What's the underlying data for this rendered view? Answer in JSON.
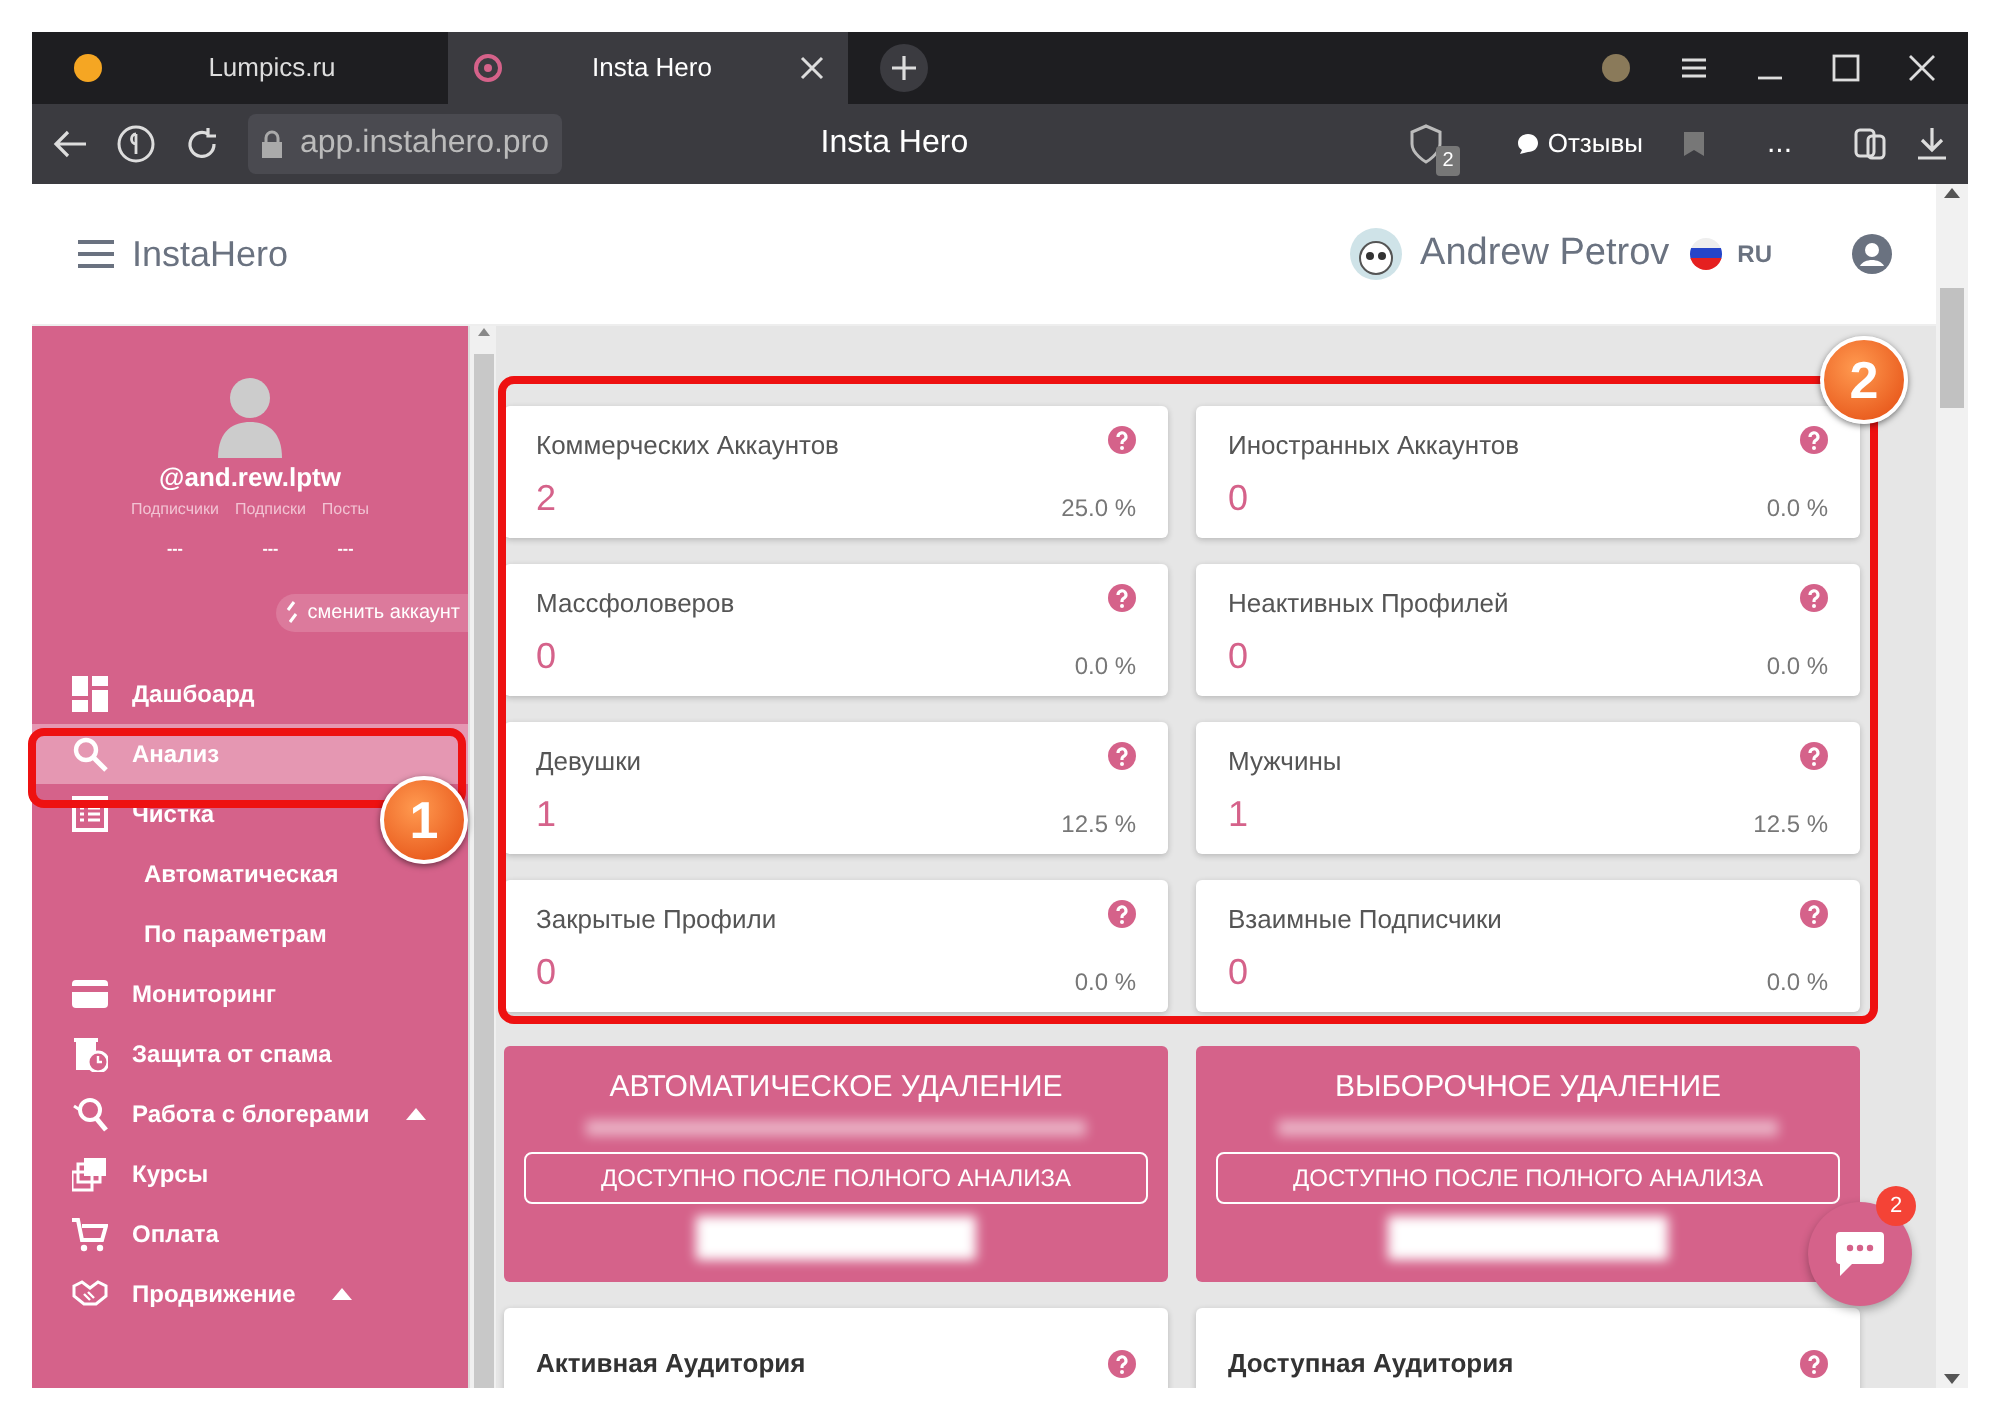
{
  "browser": {
    "tabs": [
      {
        "label": "Lumpics.ru",
        "selected": false
      },
      {
        "label": "Insta Hero",
        "selected": true
      }
    ],
    "address": "app.instahero.pro",
    "page_title": "Insta Hero",
    "shield_badge": "2",
    "reviews": "Отзывы",
    "more": "..."
  },
  "header": {
    "brand": "InstaHero",
    "user": "Andrew Petrov",
    "lang": "RU"
  },
  "profile": {
    "username": "@and.rew.lptw",
    "stats": [
      {
        "label": "Подписчики",
        "value": "---"
      },
      {
        "label": "Подписки",
        "value": "---"
      },
      {
        "label": "Посты",
        "value": "---"
      }
    ],
    "switch_account": "сменить аккаунт"
  },
  "menu": [
    {
      "label": "Дашбоард",
      "selected": false
    },
    {
      "label": "Анализ",
      "selected": true
    },
    {
      "label": "Чистка",
      "selected": false,
      "children": [
        {
          "label": "Автоматическая",
          "selected": false
        },
        {
          "label": "По параметрам",
          "selected": false
        }
      ]
    },
    {
      "label": "Мониторинг",
      "selected": false
    },
    {
      "label": "Защита от спама",
      "selected": false
    },
    {
      "label": "Работа с блогерами",
      "selected": false,
      "expanded": false
    },
    {
      "label": "Курсы",
      "selected": false
    },
    {
      "label": "Оплата",
      "selected": false
    },
    {
      "label": "Продвижение",
      "selected": false,
      "expanded": false
    }
  ],
  "stats": [
    {
      "title": "Коммерческих Аккаунтов",
      "value": "2",
      "percent": "25.0 %"
    },
    {
      "title": "Иностранных Аккаунтов",
      "value": "0",
      "percent": "0.0 %"
    },
    {
      "title": "Массфоловеров",
      "value": "0",
      "percent": "0.0 %"
    },
    {
      "title": "Неактивных Профилей",
      "value": "0",
      "percent": "0.0 %"
    },
    {
      "title": "Девушки",
      "value": "1",
      "percent": "12.5 %"
    },
    {
      "title": "Мужчины",
      "value": "1",
      "percent": "12.5 %"
    },
    {
      "title": "Закрытые Профили",
      "value": "0",
      "percent": "0.0 %"
    },
    {
      "title": "Взаимные Подписчики",
      "value": "0",
      "percent": "0.0 %"
    }
  ],
  "actions": [
    {
      "title": "АВТОМАТИЧЕСКОЕ УДАЛЕНИЕ",
      "button": "ДОСТУПНО ПОСЛЕ ПОЛНОГО АНАЛИЗА"
    },
    {
      "title": "ВЫБОРОЧНОЕ УДАЛЕНИЕ",
      "button": "ДОСТУПНО ПОСЛЕ ПОЛНОГО АНАЛИЗА"
    }
  ],
  "audience_cards": [
    {
      "title": "Активная Аудитория"
    },
    {
      "title": "Доступная Аудитория"
    }
  ],
  "chat": {
    "badge": "2"
  },
  "annotations": [
    {
      "label": "1"
    },
    {
      "label": "2"
    }
  ]
}
